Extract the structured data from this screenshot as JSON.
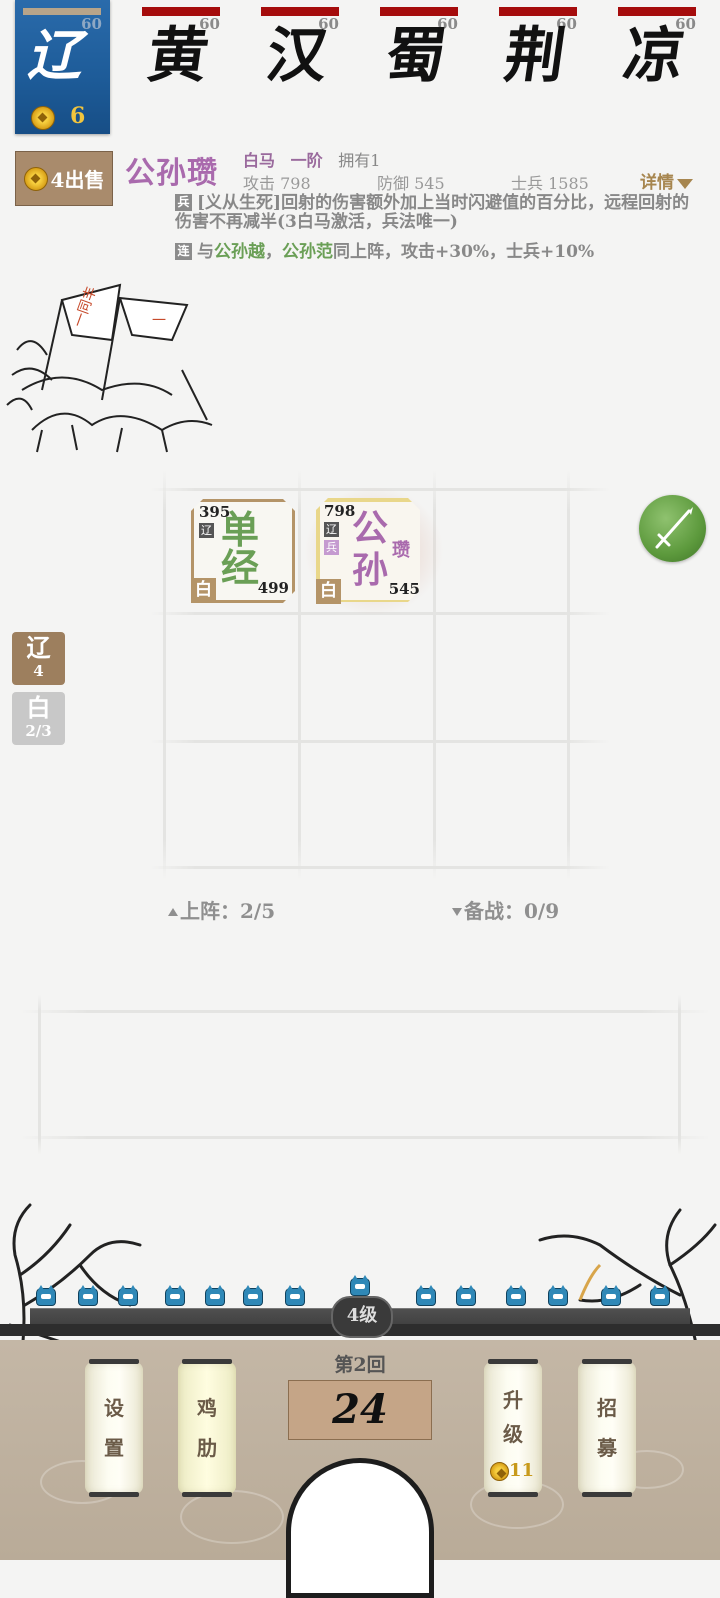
{
  "player_faction": {
    "name": "辽",
    "cap": "60",
    "gold": "6"
  },
  "enemies": [
    {
      "name": "黄",
      "cap": "60"
    },
    {
      "name": "汉",
      "cap": "60"
    },
    {
      "name": "蜀",
      "cap": "60"
    },
    {
      "name": "荆",
      "cap": "60"
    },
    {
      "name": "凉",
      "cap": "60"
    }
  ],
  "sell_button": {
    "label": "4出售"
  },
  "hero": {
    "name": "公孙瓒",
    "troop": "白马",
    "rank": "一阶",
    "owned": "拥有1",
    "attack": "攻击 798",
    "defense": "防御 545",
    "soldiers": "士兵 1585",
    "detail_label": "详情",
    "skill_tag": "兵",
    "skill_text": "[义从生死]回射的伤害额外加上当时闪避值的百分比，远程回射的伤害不再减半(3白马激活，兵法唯一)",
    "combo_tag": "连",
    "combo_prefix": "与",
    "combo_name1": "公孙越",
    "combo_sep": "，",
    "combo_name2": "公孙范",
    "combo_suffix": "同上阵，攻击+30%，士兵+10%"
  },
  "units": [
    {
      "atk": "395",
      "faction": "辽",
      "chars": "单经",
      "def": "499",
      "corner": "白"
    },
    {
      "atk": "798",
      "faction": "辽",
      "badge": "兵",
      "char1": "公",
      "char2": "孙",
      "char3": "瓒",
      "def": "545",
      "corner": "白"
    }
  ],
  "side_tags": [
    {
      "a": "辽",
      "b": "4"
    },
    {
      "a": "白",
      "b": "2/3"
    }
  ],
  "deploy_count": "上阵：2/5",
  "reserve_count": "备战：0/9",
  "level": "4级",
  "round": "第2回",
  "timer": "24",
  "buttons": {
    "settings": [
      "设",
      "置"
    ],
    "chicken": [
      "鸡",
      "肋"
    ],
    "upgrade": [
      "升",
      "级"
    ],
    "upgrade_cost": "11",
    "recruit": [
      "招",
      "募"
    ]
  },
  "colors": {
    "player": "#1d5b98",
    "enemy_hp": "#a50c0c",
    "hero_name": "#a96aad",
    "unit_green": "#6a9f56",
    "unit_purple": "#a96aad"
  }
}
